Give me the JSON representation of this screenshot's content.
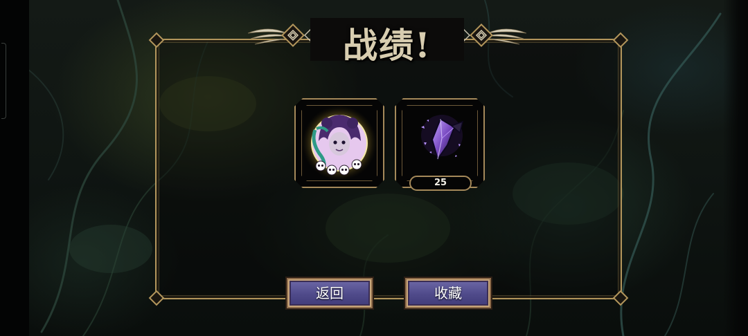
{
  "dialog": {
    "title": "战绩!"
  },
  "rewards": [
    {
      "name": "character-portrait",
      "skull_count": 4
    },
    {
      "name": "dark-crystal",
      "count": "25"
    }
  ],
  "buttons": {
    "back_label": "返回",
    "collect_label": "收藏"
  },
  "colors": {
    "frame_gold": "#b3965c",
    "button_purple": "#4f4a8a",
    "crystal_purple": "#7a4cc2"
  }
}
